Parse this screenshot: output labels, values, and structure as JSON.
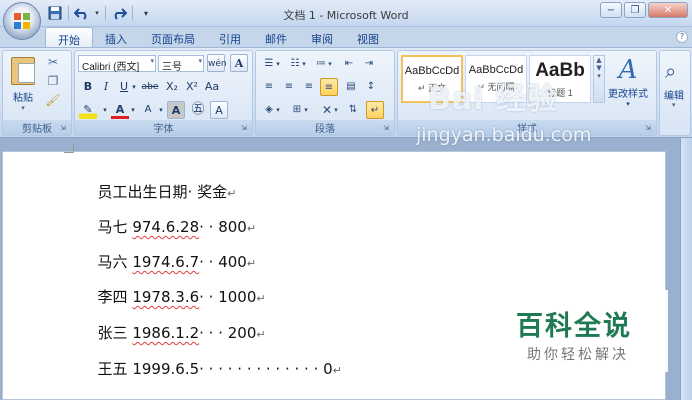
{
  "window": {
    "title": "文档 1 - Microsoft Word"
  },
  "quick_access": {
    "icons": [
      "save-icon",
      "undo-icon",
      "redo-icon",
      "customize-icon"
    ]
  },
  "window_controls": {
    "minimize": "−",
    "restore": "❐",
    "close": "✕"
  },
  "tabs": [
    {
      "label": "开始",
      "active": true
    },
    {
      "label": "插入"
    },
    {
      "label": "页面布局"
    },
    {
      "label": "引用"
    },
    {
      "label": "邮件"
    },
    {
      "label": "审阅"
    },
    {
      "label": "视图"
    }
  ],
  "ribbon": {
    "clipboard": {
      "paste_label": "粘贴",
      "group_label": "剪贴板"
    },
    "font": {
      "font_name": "Calibri (西文]",
      "font_size": "三号",
      "group_label": "字体",
      "buttons": [
        "B",
        "I",
        "U",
        "abe",
        "X₂",
        "X²",
        "Aa",
        "A",
        "A",
        "A",
        "A"
      ]
    },
    "paragraph": {
      "group_label": "段落"
    },
    "styles": {
      "items": [
        {
          "sample": "AaBbCcDd",
          "name": "↵ 正文"
        },
        {
          "sample": "AaBbCcDd",
          "name": "↵ 无间隔"
        },
        {
          "sample": "AaBb",
          "name": "标题 1"
        }
      ],
      "change_styles_label": "更改样式",
      "group_label": "样式"
    },
    "editing": {
      "label": "编辑"
    }
  },
  "document": {
    "lines": [
      {
        "text": "员工出生日期· 奖金",
        "mark": "↵"
      },
      {
        "name": "马七",
        "date": "974.6.28",
        "spacer": "· · ",
        "amount": "800",
        "mark": "↵"
      },
      {
        "name": "马六",
        "date": "1974.6.7",
        "spacer": "· · ",
        "amount": "400",
        "mark": "↵"
      },
      {
        "name": "李四",
        "date": "1978.3.6",
        "spacer": "· · ",
        "amount": "1000",
        "mark": "↵"
      },
      {
        "name": "张三",
        "date": "1986.1.2",
        "spacer": "· · · ",
        "amount": "200",
        "mark": "↵"
      },
      {
        "name": "王五",
        "date": "1999.6.5",
        "spacer": "· · · · · · · · · · · · · ",
        "amount": "0",
        "mark": "↵"
      }
    ]
  },
  "watermarks": {
    "baidu": "Bai 经验",
    "url": "jingyan.baidu.com",
    "brand": "百科全说",
    "slogan": "助你轻松解决"
  }
}
